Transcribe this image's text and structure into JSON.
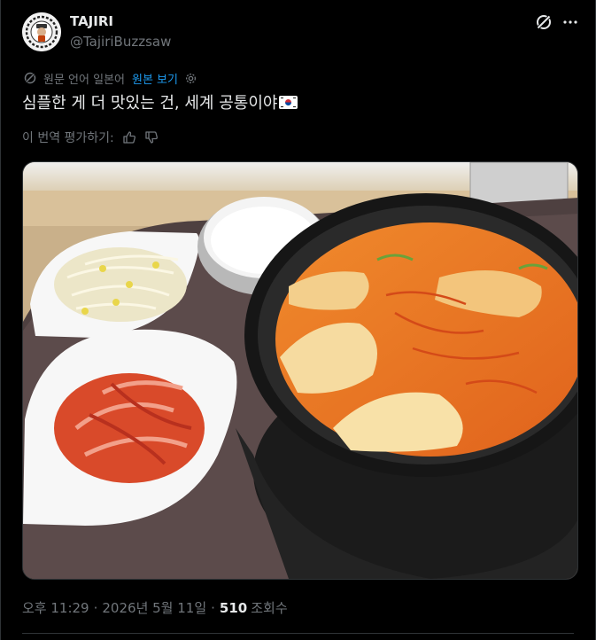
{
  "author": {
    "display_name": "TAJIRI",
    "handle": "@TajiriBuzzsaw"
  },
  "translation": {
    "note": "원문 언어 일본어",
    "show_original": "원본 보기",
    "translated_text": "심플한 게 더 맛있는 건, 세계 공통이야"
  },
  "rating": {
    "prompt": "이 번역 평가하기:"
  },
  "media": {
    "alt": "순두부찌개, 밥, 콩나물무침, 김치가 놓인 쟁반"
  },
  "meta": {
    "time": "오후 11:29",
    "separator": "·",
    "date": "2026년 5월 11일",
    "views_count": "510",
    "views_label": "조회수"
  },
  "icons": {
    "grok": "grok-icon",
    "more": "more-options-icon",
    "translate": "translate-icon",
    "settings": "settings-gear-icon",
    "thumbs_up": "thumbs-up-icon",
    "thumbs_down": "thumbs-down-icon"
  },
  "colors": {
    "background": "#000000",
    "text_primary": "#e7e9ea",
    "text_secondary": "#71767b",
    "link": "#1d9bf0",
    "border": "#2f3336"
  }
}
